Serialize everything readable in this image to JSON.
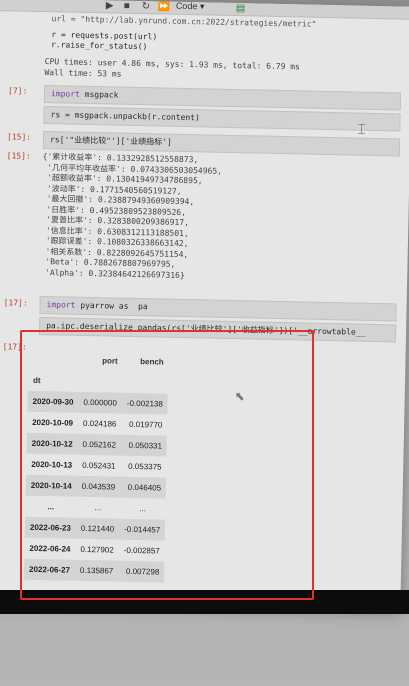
{
  "toolbar": {
    "label": "Code",
    "chevron": "▾"
  },
  "cells": [
    {
      "code": "url = \"http://lab.ynrund.com.cn:2022/strategies/metric\"\n"
    },
    {
      "code": "r = requests.post(url)\nr.raise_for_status()"
    },
    {
      "output": "CPU times: user 4.86 ms, sys: 1.93 ms, total: 6.79 ms\nWall time: 53 ms"
    },
    {
      "prompt": "[7]:",
      "code_kw": "import",
      "code_rest": " msgpack"
    },
    {
      "code": "rs = msgpack.unpackb(r.content)"
    },
    {
      "prompt": "[15]:",
      "code": "rs['\"业绩比较\"']['业绩指标']"
    },
    {
      "prompt": "[15]:",
      "output": "{'累计收益率': 0.1332928512558873,\n '几何平均年收益率': 0.0743306503054965,\n '超额收益率': 0.13041949734786895,\n '波动率': 0.1771540560519127,\n '最大回撤': 0.23887949360909394,\n '日胜率': 0.49523809523809526,\n '夏普比率': 0.3283800209386917,\n '信息比率': 0.6308312113188501,\n '跟踪误差': 0.1080326338663142,\n '相关系数': 0.8228092645751154,\n 'Beta': 0.7882678807969795,\n 'Alpha': 0.32384642126697316}"
    },
    {
      "prompt": "[17]:",
      "code_kw": "import",
      "code_rest": " pyarrow as  pa"
    },
    {
      "code": "pa.ipc.deserialize_pandas(rs['业绩比较']['收益指标'])['__arrowtable__"
    },
    {
      "prompt": "[17]:"
    }
  ],
  "dataframe": {
    "columns": [
      "port",
      "bench"
    ],
    "index_name": "dt",
    "rows": [
      {
        "dt": "2020-09-30",
        "port": "0.000000",
        "bench": "-0.002138"
      },
      {
        "dt": "2020-10-09",
        "port": "0.024186",
        "bench": "0.019770"
      },
      {
        "dt": "2020-10-12",
        "port": "0.052162",
        "bench": "0.050331"
      },
      {
        "dt": "2020-10-13",
        "port": "0.052431",
        "bench": "0.053375"
      },
      {
        "dt": "2020-10-14",
        "port": "0.043539",
        "bench": "0.046405"
      },
      {
        "dt": "...",
        "port": "...",
        "bench": "..."
      },
      {
        "dt": "2022-06-23",
        "port": "0.121440",
        "bench": "-0.014457"
      },
      {
        "dt": "2022-06-24",
        "port": "0.127902",
        "bench": "-0.002857"
      },
      {
        "dt": "2022-06-27",
        "port": "0.135867",
        "bench": "0.007298"
      }
    ]
  },
  "colors": {
    "highlight_box": "#e0312e",
    "prompt": "#c0392b",
    "keyword": "#7a3e9d"
  }
}
